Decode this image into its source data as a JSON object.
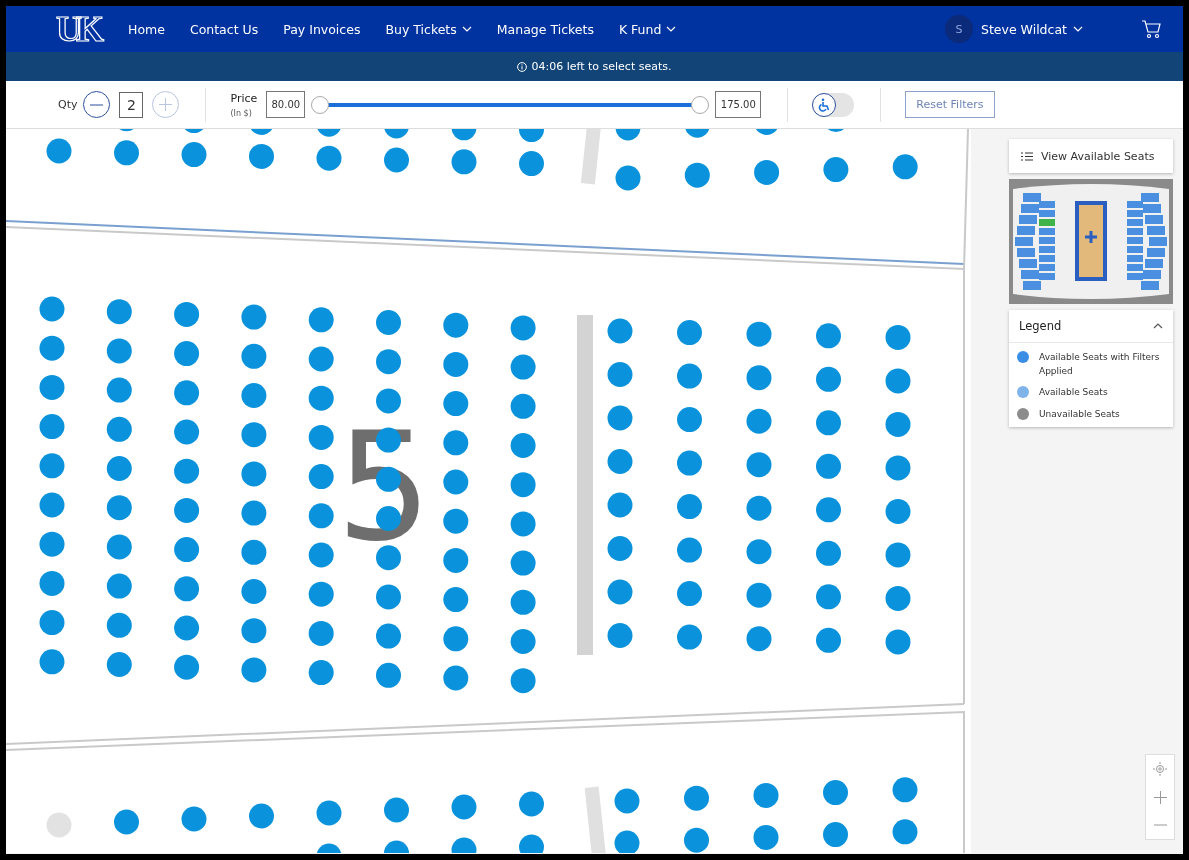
{
  "nav": {
    "logo": "UK",
    "links": [
      {
        "label": "Home",
        "dropdown": false
      },
      {
        "label": "Contact Us",
        "dropdown": false
      },
      {
        "label": "Pay Invoices",
        "dropdown": false
      },
      {
        "label": "Buy Tickets",
        "dropdown": true
      },
      {
        "label": "Manage Tickets",
        "dropdown": false
      },
      {
        "label": "K Fund",
        "dropdown": true
      }
    ],
    "user": {
      "initial": "S",
      "name": "Steve Wildcat"
    }
  },
  "timer": {
    "text": "04:06 left to select seats."
  },
  "filters": {
    "qty_label": "Qty",
    "qty": "2",
    "price_label": "Price",
    "price_unit": "(In $)",
    "min_price": "80.00",
    "max_price": "175.00",
    "thumbs": [
      {
        "level": 0
      },
      {
        "level": 1
      }
    ],
    "accessible_only": false,
    "reset_label": "Reset Filters"
  },
  "map": {
    "section_label": "5",
    "seat_blocks": [
      {
        "kind": "top_left",
        "first_seat_unavailable": false
      },
      {
        "kind": "top_right",
        "first_seat_unavailable": false
      },
      {
        "kind": "main_left",
        "first_seat_unavailable": false
      },
      {
        "kind": "main_right",
        "first_seat_unavailable": false
      },
      {
        "kind": "bottom_left",
        "first_seat_unavailable": true
      },
      {
        "kind": "bottom_right",
        "first_seat_unavailable": false
      }
    ]
  },
  "side": {
    "view_label": "View Available Seats",
    "legend_title": "Legend",
    "legend_expanded": true,
    "legend": [
      {
        "label": "Available Seats with Filters Applied",
        "color": "#3b8ee6"
      },
      {
        "label": "Available Seats",
        "color": "#7fb3ea"
      },
      {
        "label": "Unavailable Seats",
        "color": "#8c8c8c"
      }
    ]
  }
}
